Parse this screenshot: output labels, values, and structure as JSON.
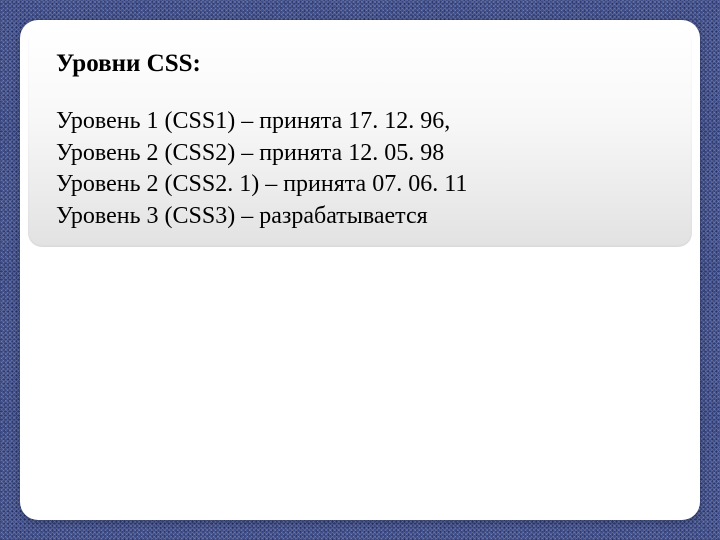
{
  "slide": {
    "title": "Уровни CSS:",
    "lines": [
      "Уровень 1 (CSS1) – принята 17. 12. 96,",
      "Уровень 2 (CSS2) – принята 12. 05. 98",
      "Уровень 2 (CSS2. 1) – принята  07. 06. 11",
      "Уровень 3 (CSS3) – разрабатывается"
    ]
  }
}
